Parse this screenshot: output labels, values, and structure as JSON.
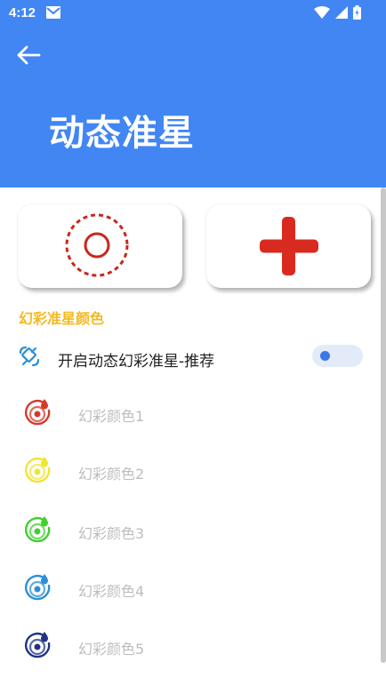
{
  "status_bar": {
    "time": "4:12"
  },
  "header": {
    "title": "动态准星"
  },
  "section": {
    "title": "幻彩准星颜色"
  },
  "toggle": {
    "label": "开启动态幻彩准星-推荐",
    "enabled": false
  },
  "colors": [
    {
      "label": "幻彩颜色1",
      "color": "#D43A2A"
    },
    {
      "label": "幻彩颜色2",
      "color": "#F0E530"
    },
    {
      "label": "幻彩颜色3",
      "color": "#3FD02E"
    },
    {
      "label": "幻彩颜色4",
      "color": "#2C8FD6"
    },
    {
      "label": "幻彩颜色5",
      "color": "#233385"
    }
  ],
  "theme": {
    "primary": "#4286F3",
    "accent": "#F5B91E",
    "crosshair_red": "#D82A1E"
  }
}
